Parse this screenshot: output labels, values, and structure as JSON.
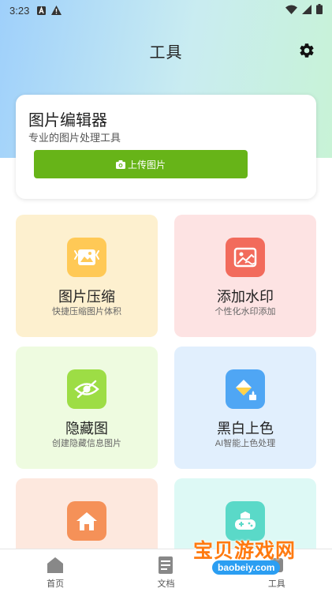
{
  "status_bar": {
    "time": "3:23"
  },
  "header": {
    "title": "工具"
  },
  "editor": {
    "title": "图片编辑器",
    "subtitle": "专业的图片处理工具",
    "upload_label": "上传图片"
  },
  "tools": [
    {
      "title": "图片压缩",
      "subtitle": "快捷压缩图片体积",
      "icon": "image-compress-icon",
      "bg": "#fdf0cf",
      "icon_color": "#ffc956"
    },
    {
      "title": "添加水印",
      "subtitle": "个性化水印添加",
      "icon": "watermark-icon",
      "bg": "#fde3e3",
      "icon_color": "#f26b5c"
    },
    {
      "title": "隐藏图",
      "subtitle": "创建隐藏信息图片",
      "icon": "eye-off-icon",
      "bg": "#eefbe0",
      "icon_color": "#9ddd45"
    },
    {
      "title": "黑白上色",
      "subtitle": "AI智能上色处理",
      "icon": "paint-bucket-icon",
      "bg": "#e1effd",
      "icon_color": "#4fa6f4"
    },
    {
      "title": "",
      "subtitle": "",
      "icon": "home-icon",
      "bg": "#fde8de",
      "icon_color": "#f59158"
    },
    {
      "title": "",
      "subtitle": "",
      "icon": "game-icon",
      "bg": "#ddf9f5",
      "icon_color": "#5ad9c8"
    }
  ],
  "bottom_nav": [
    {
      "label": "首页",
      "icon": "home-icon"
    },
    {
      "label": "文档",
      "icon": "document-icon"
    },
    {
      "label": "工具",
      "icon": "tools-icon"
    }
  ],
  "watermark": {
    "text": "宝贝游戏网",
    "url": "baobeiy.com"
  }
}
